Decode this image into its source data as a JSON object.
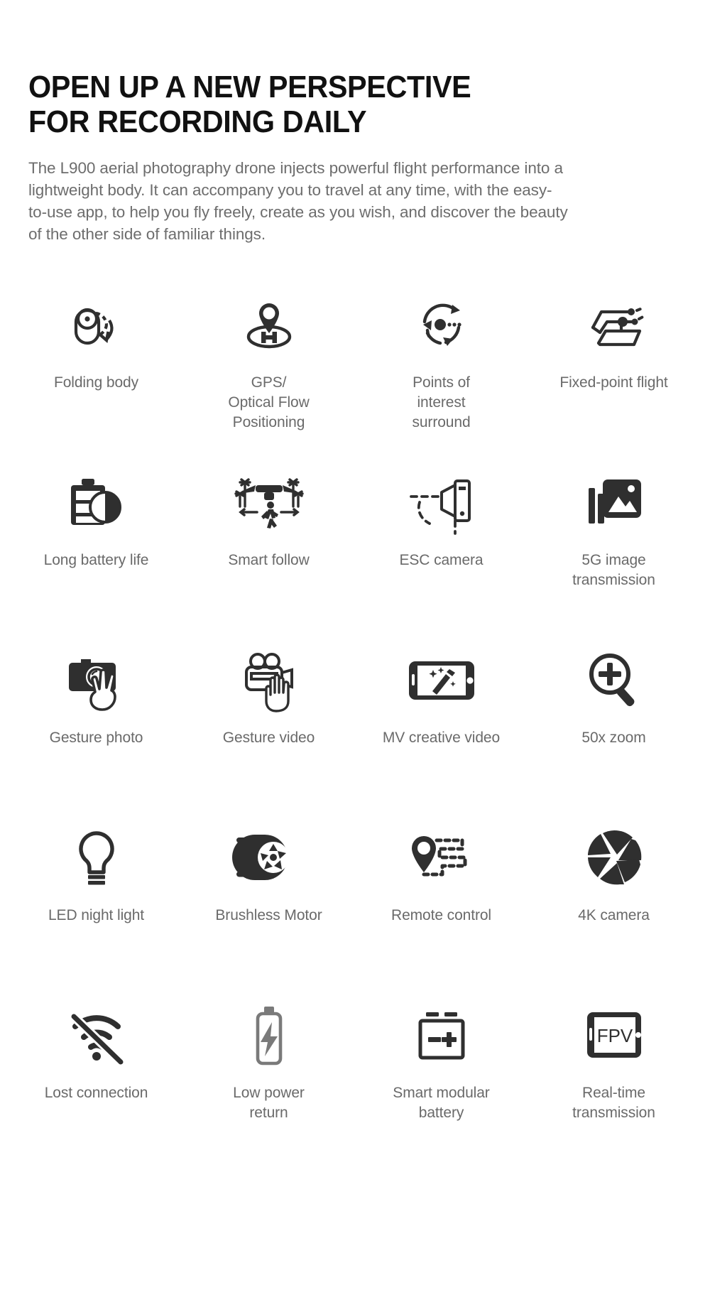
{
  "hero": {
    "title": "OPEN UP A NEW PERSPECTIVE\nFOR RECORDING DAILY",
    "description": "The L900 aerial photography drone injects powerful flight performance into a lightweight body. It can accompany you to travel at any time, with the easy-to-use app, to help you fly freely, create as you wish, and discover the beauty of the other side of familiar things."
  },
  "colors": {
    "background": "#ffffff",
    "title": "#111111",
    "body_text": "#6d6d6d",
    "label_text": "#6a6a6a",
    "icon_dark": "#2f2f2f",
    "icon_gray": "#7a7a7a"
  },
  "features": [
    {
      "label": "Folding body",
      "icon": "folding-body-icon"
    },
    {
      "label": "GPS/\nOptical Flow\nPositioning",
      "icon": "gps-positioning-icon"
    },
    {
      "label": "Points of\ninterest\nsurround",
      "icon": "points-of-interest-surround-icon"
    },
    {
      "label": "Fixed-point flight",
      "icon": "fixed-point-flight-icon"
    },
    {
      "label": "Long battery life",
      "icon": "battery-life-icon"
    },
    {
      "label": "Smart follow",
      "icon": "smart-follow-icon"
    },
    {
      "label": "ESC camera",
      "icon": "esc-camera-icon"
    },
    {
      "label": "5G image\ntransmission",
      "icon": "image-transmission-icon"
    },
    {
      "label": "Gesture photo",
      "icon": "gesture-photo-icon"
    },
    {
      "label": "Gesture video",
      "icon": "gesture-video-icon"
    },
    {
      "label": "MV creative video",
      "icon": "mv-creative-video-icon"
    },
    {
      "label": "50x zoom",
      "icon": "zoom-in-icon"
    },
    {
      "label": "LED night light",
      "icon": "lightbulb-icon"
    },
    {
      "label": "Brushless Motor",
      "icon": "brushless-motor-icon"
    },
    {
      "label": "Remote control",
      "icon": "remote-control-route-icon"
    },
    {
      "label": "4K camera",
      "icon": "camera-shutter-icon"
    },
    {
      "label": "Lost connection",
      "icon": "wifi-off-icon"
    },
    {
      "label": "Low power\nreturn",
      "icon": "low-battery-icon"
    },
    {
      "label": "Smart modular\nbattery",
      "icon": "modular-battery-icon"
    },
    {
      "label": "Real-time\ntransmission",
      "icon": "fpv-screen-icon",
      "screen_text": "FPV"
    }
  ]
}
